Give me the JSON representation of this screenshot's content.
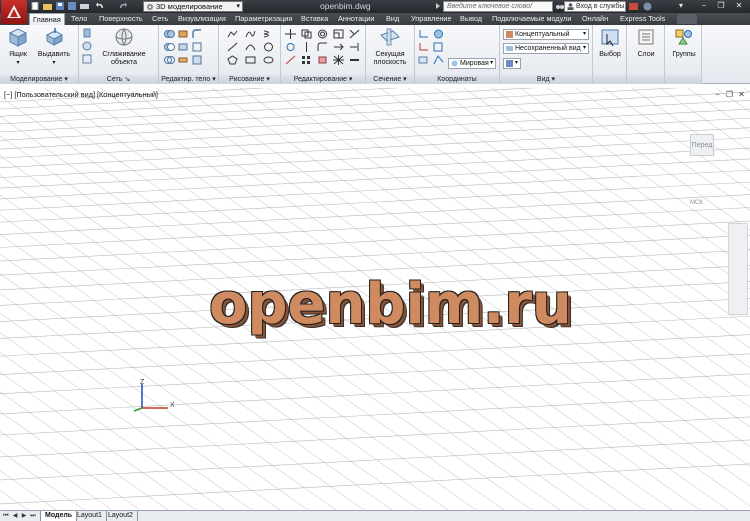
{
  "titlebar": {
    "app_letter": "A",
    "workspace": "3D моделирование",
    "document_title": "openbim.dwg",
    "search_placeholder": "Введите ключевое слово/фразу",
    "signin": "Вход в службы"
  },
  "tabs": [
    {
      "label": "Главная",
      "active": true
    },
    {
      "label": "Тело"
    },
    {
      "label": "Поверхность"
    },
    {
      "label": "Сеть"
    },
    {
      "label": "Визуализация"
    },
    {
      "label": "Параметризация"
    },
    {
      "label": "Вставка"
    },
    {
      "label": "Аннотации"
    },
    {
      "label": "Вид"
    },
    {
      "label": "Управление"
    },
    {
      "label": "Вывод"
    },
    {
      "label": "Подключаемые модули"
    },
    {
      "label": "Онлайн"
    },
    {
      "label": "Express Tools"
    }
  ],
  "ribbon": {
    "box_label": "Ящик",
    "extrude_label": "Выдавить",
    "smooth_label_1": "Сглаживание",
    "smooth_label_2": "объекта",
    "section_label_1": "Секущая",
    "section_label_2": "плоскость",
    "visual_style": "Концептуальный",
    "saved_view": "Несохраненный вид",
    "ucs_world": "Мировая",
    "select_label": "Выбор",
    "layers_label": "Слои",
    "groups_label": "Группы",
    "panels": [
      "Моделирование",
      "Сеть",
      "Редактир. тело",
      "Рисование",
      "Редактирование",
      "Сечение",
      "Координаты",
      "Вид"
    ]
  },
  "viewport": {
    "label": "[−] [Пользовательский вид] [Концептуальный]",
    "watermark": "openbim.ru",
    "viewcube_face": "Перед",
    "wcs": "МСК",
    "ucs_z": "Z",
    "ucs_x": "X"
  },
  "layout_tabs": [
    "Модель",
    "Layout1",
    "Layout2"
  ],
  "colors": {
    "title_bg": "#2f3237",
    "ribbon_bg": "#eef1f5",
    "grid_line": "#b9b9b9",
    "watermark_fill": "#cf8a5f"
  }
}
